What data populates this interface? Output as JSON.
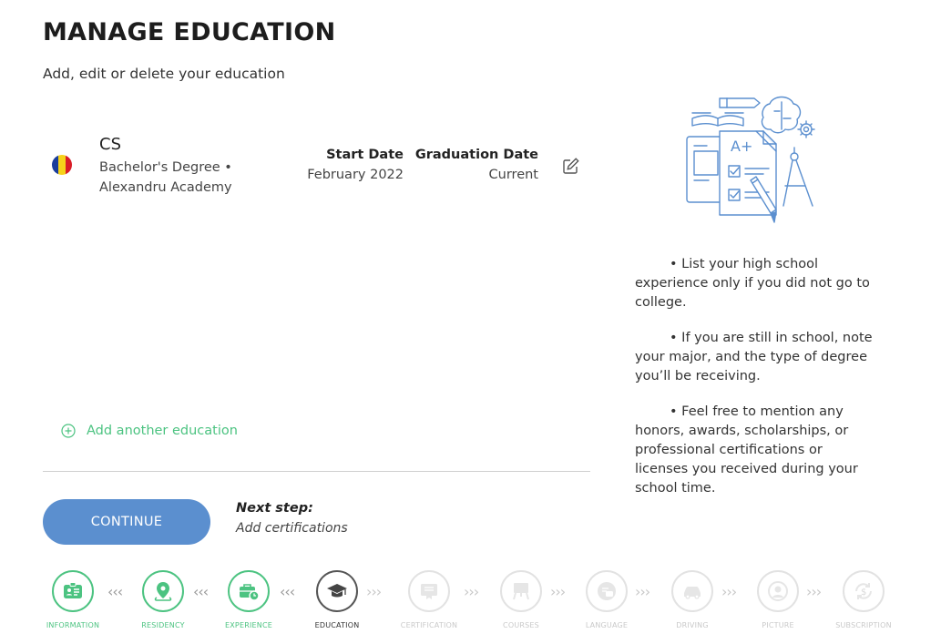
{
  "header": {
    "title": "MANAGE EDUCATION",
    "subtitle": "Add, edit or delete your education"
  },
  "education": {
    "field": "CS",
    "degree": "Bachelor's Degree •",
    "school": "Alexandru Academy",
    "start_label": "Start Date",
    "start_value": "February 2022",
    "grad_label": "Graduation Date",
    "grad_value": "Current",
    "flag_colors": [
      "#1a3d9c",
      "#f6d21a",
      "#d91c27"
    ]
  },
  "add_label": "Add another education",
  "continue_label": "CONTINUE",
  "next_step": {
    "label": "Next step:",
    "value": "Add certifications"
  },
  "tips": [
    "• List your high school experience only if you did not go to college.",
    "• If you are still in school, note your major, and the type of degree you’ll be receiving.",
    "• Feel free to mention any honors, awards, scholarships, or professional certifications or licenses you received during your school time."
  ],
  "colors": {
    "accent_green": "#4cc381",
    "button_blue": "#5b8fcf",
    "illustration_blue": "#5b8fcf"
  },
  "steps": [
    {
      "label": "INFORMATION",
      "status": "done",
      "icon": "id-card-icon"
    },
    {
      "label": "RESIDENCY",
      "status": "done",
      "icon": "map-pin-icon"
    },
    {
      "label": "EXPERIENCE",
      "status": "done",
      "icon": "briefcase-clock-icon"
    },
    {
      "label": "EDUCATION",
      "status": "active",
      "icon": "graduation-cap-icon"
    },
    {
      "label": "CERTIFICATION",
      "status": "todo",
      "icon": "certificate-icon"
    },
    {
      "label": "COURSES",
      "status": "todo",
      "icon": "presentation-board-icon"
    },
    {
      "label": "LANGUAGE",
      "status": "todo",
      "icon": "speech-bubbles-icon"
    },
    {
      "label": "DRIVING",
      "status": "todo",
      "icon": "car-icon"
    },
    {
      "label": "PICTURE",
      "status": "todo",
      "icon": "portrait-icon"
    },
    {
      "label": "SUBSCRIPTION",
      "status": "todo",
      "icon": "dollar-cycle-icon"
    }
  ],
  "chevrons": {
    "back": "‹‹‹",
    "forward": "›››"
  }
}
